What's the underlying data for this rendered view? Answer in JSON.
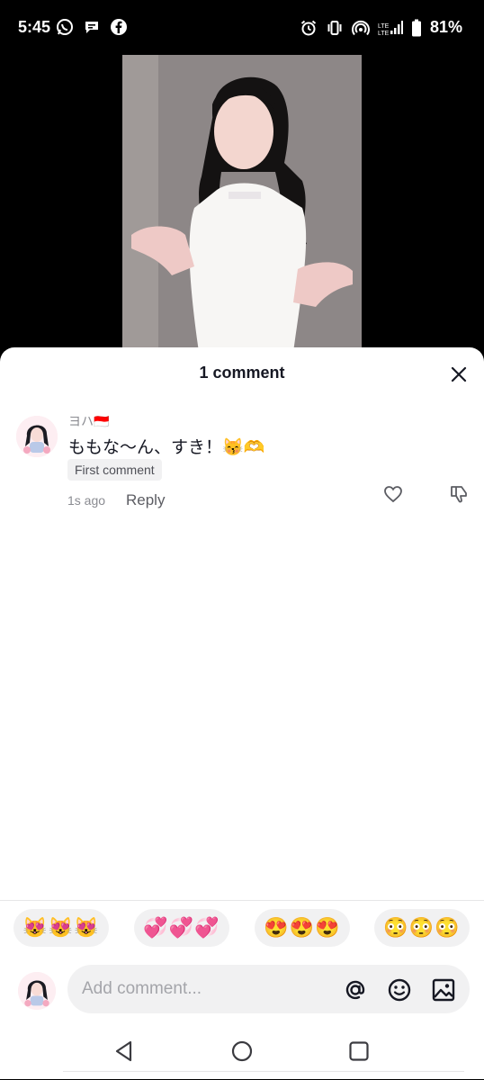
{
  "status_bar": {
    "time": "5:45",
    "battery": "81%"
  },
  "sheet": {
    "title": "1 comment",
    "comment": {
      "username": "ヨハ🇮🇩",
      "text": "ももな〜ん、すき！😽🫶",
      "badge": "First comment",
      "time": "1s ago",
      "reply_label": "Reply"
    },
    "emoji_suggestions": [
      "😻😻😻",
      "💞💞💞",
      "😍😍😍",
      "😳😳😳"
    ],
    "composer": {
      "placeholder": "Add comment..."
    }
  },
  "colors": {
    "accent_text": "#161823",
    "muted_text": "#8a8b91",
    "pill_bg": "#f1f1f2"
  },
  "icons": [
    "whatsapp-icon",
    "chat-icon",
    "facebook-icon",
    "alarm-icon",
    "vibrate-icon",
    "hotspot-icon",
    "signal-icon",
    "battery-icon",
    "close-icon",
    "heart-icon",
    "dislike-icon",
    "mention-icon",
    "emoji-icon",
    "image-icon",
    "back-icon",
    "home-icon",
    "recents-icon"
  ]
}
